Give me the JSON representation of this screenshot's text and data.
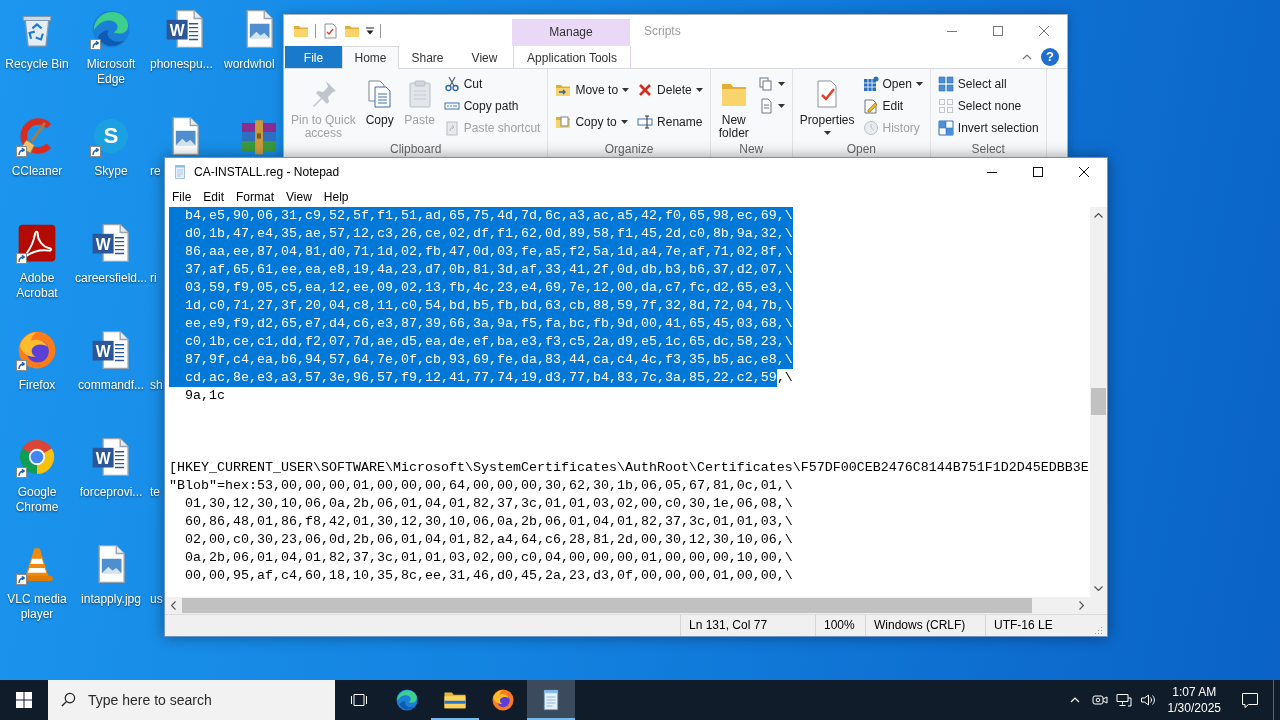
{
  "desktop_icons": [
    [
      {
        "label": "Recycle Bin",
        "kind": "recycle-bin",
        "shortcut": false
      },
      {
        "label": "CCleaner",
        "kind": "ccleaner",
        "shortcut": true
      },
      {
        "label": "Adobe Acrobat",
        "kind": "acrobat",
        "shortcut": true
      },
      {
        "label": "Firefox",
        "kind": "firefox",
        "shortcut": true
      },
      {
        "label": "Google Chrome",
        "kind": "chrome",
        "shortcut": true
      },
      {
        "label": "VLC media player",
        "kind": "vlc",
        "shortcut": true
      }
    ],
    [
      {
        "label": "Microsoft Edge",
        "kind": "edge",
        "shortcut": true
      },
      {
        "label": "Skype",
        "kind": "skype",
        "glyph": "S",
        "shortcut": true
      },
      {
        "label": "careersfield...",
        "kind": "word",
        "glyph": "W",
        "shortcut": false
      },
      {
        "label": "commandf...",
        "kind": "word",
        "glyph": "W",
        "shortcut": false
      },
      {
        "label": "forceprovi...",
        "kind": "word",
        "glyph": "W",
        "shortcut": false
      },
      {
        "label": "intapply.jpg",
        "kind": "image",
        "shortcut": false
      }
    ],
    [
      {
        "label": "phonespu...",
        "kind": "word",
        "glyph": "W",
        "shortcut": false
      },
      {
        "label": "re",
        "kind": "image",
        "shortcut": false
      },
      {
        "label": "ri",
        "kind": "label-only"
      },
      {
        "label": "sh",
        "kind": "label-only"
      },
      {
        "label": "te",
        "kind": "label-only"
      },
      {
        "label": "us",
        "kind": "label-only"
      }
    ],
    [
      {
        "label": "wordwhol",
        "kind": "image",
        "shortcut": false
      },
      {
        "kind": "archive",
        "shortcut": false
      }
    ]
  ],
  "explorer": {
    "context_header": "Manage",
    "title": "Scripts",
    "help": "?",
    "tabs": [
      {
        "label": "File",
        "kind": "file-menu",
        "selected": false
      },
      {
        "label": "Home",
        "kind": "tab",
        "selected": true
      },
      {
        "label": "Share",
        "kind": "tab",
        "selected": false
      },
      {
        "label": "View",
        "kind": "tab",
        "selected": false
      },
      {
        "label": "Application Tools",
        "kind": "contextual",
        "selected": false
      }
    ],
    "groups": [
      {
        "label": "Clipboard",
        "columns": [
          [
            {
              "kind": "large",
              "lines": [
                "Pin to Quick",
                "access"
              ],
              "disabled": true,
              "dropdown": false
            }
          ],
          [
            {
              "kind": "large",
              "lines": [
                "Copy"
              ],
              "disabled": false,
              "dropdown": false
            }
          ],
          [
            {
              "kind": "large",
              "lines": [
                "Paste"
              ],
              "disabled": true,
              "dropdown": false
            }
          ],
          [
            {
              "kind": "small",
              "label": "Cut",
              "disabled": false,
              "dropdown": false
            },
            {
              "kind": "small",
              "label": "Copy path",
              "disabled": false,
              "dropdown": false
            },
            {
              "kind": "small",
              "label": "Paste shortcut",
              "disabled": true,
              "dropdown": false
            }
          ]
        ]
      },
      {
        "label": "Organize",
        "columns": [
          [
            {
              "kind": "small",
              "label": "Move to",
              "disabled": false,
              "dropdown": true
            },
            {
              "kind": "small",
              "label": "Copy to",
              "disabled": false,
              "dropdown": true
            }
          ],
          [
            {
              "kind": "small",
              "label": "Delete",
              "disabled": false,
              "dropdown": true
            },
            {
              "kind": "small",
              "label": "Rename",
              "disabled": false,
              "dropdown": false
            }
          ]
        ]
      },
      {
        "label": "New",
        "columns": [
          [
            {
              "kind": "large",
              "lines": [
                "New",
                "folder"
              ],
              "disabled": false,
              "dropdown": false
            }
          ],
          [
            {
              "kind": "icon",
              "disabled": false,
              "dropdown": true
            },
            {
              "kind": "icon",
              "disabled": false,
              "dropdown": true
            }
          ]
        ]
      },
      {
        "label": "Open",
        "columns": [
          [
            {
              "kind": "large",
              "lines": [
                "Properties"
              ],
              "disabled": false,
              "dropdown": true
            }
          ],
          [
            {
              "kind": "small",
              "label": "Open",
              "disabled": false,
              "dropdown": true
            },
            {
              "kind": "small",
              "label": "Edit",
              "disabled": false,
              "dropdown": false
            },
            {
              "kind": "small",
              "label": "History",
              "disabled": true,
              "dropdown": false
            }
          ]
        ]
      },
      {
        "label": "Select",
        "columns": [
          [
            {
              "kind": "small",
              "label": "Select all",
              "disabled": false,
              "dropdown": false
            },
            {
              "kind": "small",
              "label": "Select none",
              "disabled": false,
              "dropdown": false
            },
            {
              "kind": "small",
              "label": "Invert selection",
              "disabled": false,
              "dropdown": false
            }
          ]
        ]
      }
    ]
  },
  "notepad": {
    "title": "CA-INSTALL.reg - Notepad",
    "menu": [
      "File",
      "Edit",
      "Format",
      "View",
      "Help"
    ],
    "lines": [
      {
        "kind": "text",
        "spans": [
          {
            "text": "  b4,e5,90,06,31,c9,52,5f,f1,51,ad,65,75,4d,7d,6c,a3,ac,a5,42,f0,65,98,ec,69,\\",
            "selected": true
          }
        ]
      },
      {
        "kind": "text",
        "spans": [
          {
            "text": "  d0,1b,47,e4,35,ae,57,12,c3,26,ce,02,df,f1,62,0d,89,58,f1,45,2d,c0,8b,9a,32,\\",
            "selected": true
          }
        ]
      },
      {
        "kind": "text",
        "spans": [
          {
            "text": "  86,aa,ee,87,04,81,d0,71,1d,02,fb,47,0d,03,fe,a5,f2,5a,1d,a4,7e,af,71,02,8f,\\",
            "selected": true
          }
        ]
      },
      {
        "kind": "text",
        "spans": [
          {
            "text": "  37,af,65,61,ee,ea,e8,19,4a,23,d7,0b,81,3d,af,33,41,2f,0d,db,b3,b6,37,d2,07,\\",
            "selected": true
          }
        ]
      },
      {
        "kind": "text",
        "spans": [
          {
            "text": "  03,59,f9,05,c5,ea,12,ee,09,02,13,fb,4c,23,e4,69,7e,12,00,da,c7,fc,d2,65,e3,\\",
            "selected": true
          }
        ]
      },
      {
        "kind": "text",
        "spans": [
          {
            "text": "  1d,c0,71,27,3f,20,04,c8,11,c0,54,bd,b5,fb,bd,63,cb,88,59,7f,32,8d,72,04,7b,\\",
            "selected": true
          }
        ]
      },
      {
        "kind": "text",
        "spans": [
          {
            "text": "  ee,e9,f9,d2,65,e7,d4,c6,e3,87,39,66,3a,9a,f5,fa,bc,fb,9d,00,41,65,45,03,68,\\",
            "selected": true
          }
        ]
      },
      {
        "kind": "text",
        "spans": [
          {
            "text": "  c0,1b,ce,c1,dd,f2,07,7d,ae,d5,ea,de,ef,ba,e3,f3,c5,2a,d9,e5,1c,65,dc,58,23,\\",
            "selected": true
          }
        ]
      },
      {
        "kind": "text",
        "spans": [
          {
            "text": "  87,9f,c4,ea,b6,94,57,64,7e,0f,cb,93,69,fe,da,83,44,ca,c4,4c,f3,35,b5,ac,e8,\\",
            "selected": true
          }
        ]
      },
      {
        "kind": "text",
        "spans": [
          {
            "text": "  cd,ac,8e,e3,a3,57,3e,96,57,f9,12,41,77,74,19,d3,77,b4,83,7c,3a,85,22,c2,59",
            "selected": true
          },
          {
            "text": ",\\",
            "selected": false
          }
        ]
      },
      {
        "kind": "text",
        "spans": [
          {
            "text": "  9a,1c",
            "selected": false
          }
        ]
      },
      {
        "kind": "blank"
      },
      {
        "kind": "blank"
      },
      {
        "kind": "blank"
      },
      {
        "kind": "text",
        "spans": [
          {
            "text": "[HKEY_CURRENT_USER\\SOFTWARE\\Microsoft\\SystemCertificates\\AuthRoot\\Certificates\\F57DF00CEB2476C8144B751F1D2D45EDBB3E",
            "selected": false
          }
        ]
      },
      {
        "kind": "text",
        "spans": [
          {
            "text": "\"Blob\"=hex:53,00,00,00,01,00,00,00,64,00,00,00,30,62,30,1b,06,05,67,81,0c,01,\\",
            "selected": false
          }
        ]
      },
      {
        "kind": "text",
        "spans": [
          {
            "text": "  01,30,12,30,10,06,0a,2b,06,01,04,01,82,37,3c,01,01,03,02,00,c0,30,1e,06,08,\\",
            "selected": false
          }
        ]
      },
      {
        "kind": "text",
        "spans": [
          {
            "text": "  60,86,48,01,86,f8,42,01,30,12,30,10,06,0a,2b,06,01,04,01,82,37,3c,01,01,03,\\",
            "selected": false
          }
        ]
      },
      {
        "kind": "text",
        "spans": [
          {
            "text": "  02,00,c0,30,23,06,0d,2b,06,01,04,01,82,a4,64,c6,28,81,2d,00,30,12,30,10,06,\\",
            "selected": false
          }
        ]
      },
      {
        "kind": "text",
        "spans": [
          {
            "text": "  0a,2b,06,01,04,01,82,37,3c,01,01,03,02,00,c0,04,00,00,00,01,00,00,00,10,00,\\",
            "selected": false
          }
        ]
      },
      {
        "kind": "text",
        "spans": [
          {
            "text": "  00,00,95,af,c4,60,18,10,35,8c,ee,31,46,d0,45,2a,23,d3,0f,00,00,00,01,00,00,\\",
            "selected": false
          }
        ]
      }
    ],
    "status": [
      "Ln 131, Col 77",
      "100%",
      "Windows (CRLF)",
      "UTF-16 LE"
    ]
  },
  "taskbar": {
    "search": {
      "placeholder": "Type here to search"
    },
    "apps": [
      {
        "kind": "edge",
        "running": false,
        "selected": false
      },
      {
        "kind": "file-explorer",
        "running": true,
        "selected": false
      },
      {
        "kind": "firefox",
        "running": false,
        "selected": false
      },
      {
        "kind": "notepad",
        "running": true,
        "selected": true
      }
    ],
    "clock": {
      "time": "1:07 AM",
      "date": "1/30/2025"
    }
  }
}
